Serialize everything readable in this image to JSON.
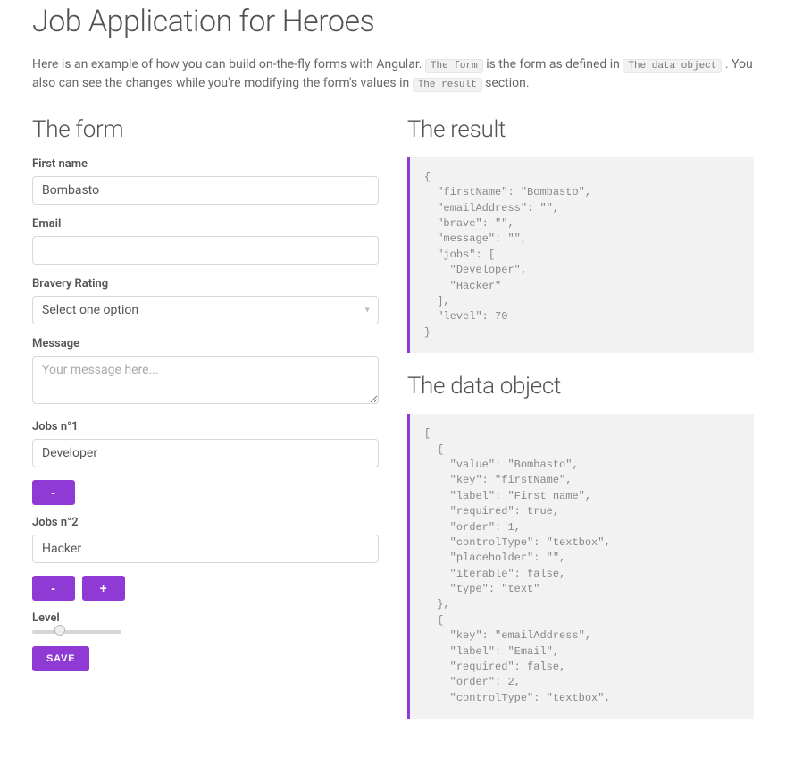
{
  "page": {
    "title": "Job Application for Heroes",
    "intro_before": "Here is an example of how you can build on-the-fly forms with Angular. ",
    "code1": "The form",
    "intro_mid1": " is the form as defined in ",
    "code2": "The data object",
    "intro_mid2": ". You also can see the changes while you're modifying the form's values in ",
    "code3": "The result",
    "intro_after": " section."
  },
  "sections": {
    "form_heading": "The form",
    "result_heading": "The result",
    "data_heading": "The data object"
  },
  "form": {
    "firstName": {
      "label": "First name",
      "value": "Bombasto"
    },
    "email": {
      "label": "Email",
      "value": ""
    },
    "bravery": {
      "label": "Bravery Rating",
      "placeholder": "Select one option"
    },
    "message": {
      "label": "Message",
      "placeholder": "Your message here..."
    },
    "jobs": {
      "items": [
        {
          "label": "Jobs n°1",
          "value": "Developer"
        },
        {
          "label": "Jobs n°2",
          "value": "Hacker"
        }
      ]
    },
    "level": {
      "label": "Level",
      "value": 70,
      "min": 0,
      "max": 250
    },
    "buttons": {
      "minus": "-",
      "plus": "+",
      "save": "Save"
    }
  },
  "result_json": "{\n  \"firstName\": \"Bombasto\",\n  \"emailAddress\": \"\",\n  \"brave\": \"\",\n  \"message\": \"\",\n  \"jobs\": [\n    \"Developer\",\n    \"Hacker\"\n  ],\n  \"level\": 70\n}",
  "data_json": "[\n  {\n    \"value\": \"Bombasto\",\n    \"key\": \"firstName\",\n    \"label\": \"First name\",\n    \"required\": true,\n    \"order\": 1,\n    \"controlType\": \"textbox\",\n    \"placeholder\": \"\",\n    \"iterable\": false,\n    \"type\": \"text\"\n  },\n  {\n    \"key\": \"emailAddress\",\n    \"label\": \"Email\",\n    \"required\": false,\n    \"order\": 2,\n    \"controlType\": \"textbox\","
}
